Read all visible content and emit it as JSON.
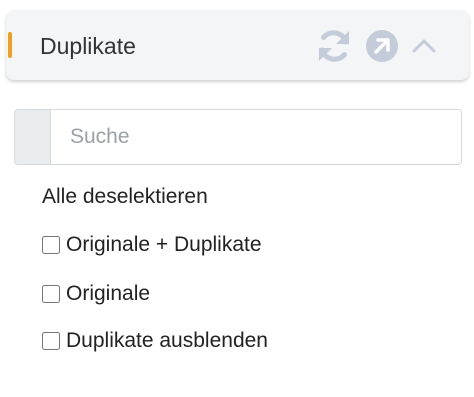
{
  "panel": {
    "title": "Duplikate",
    "accent_color": "#f0a020",
    "icons": {
      "refresh": "refresh-icon",
      "open": "external-link-icon",
      "collapse": "chevron-up-icon"
    }
  },
  "search": {
    "placeholder": "Suche",
    "value": ""
  },
  "actions": {
    "deselect_all": "Alle deselektieren"
  },
  "options": [
    {
      "label": "Originale + Duplikate",
      "checked": false
    },
    {
      "label": "Originale",
      "checked": false
    },
    {
      "label": "Duplikate ausblenden",
      "checked": false
    }
  ]
}
